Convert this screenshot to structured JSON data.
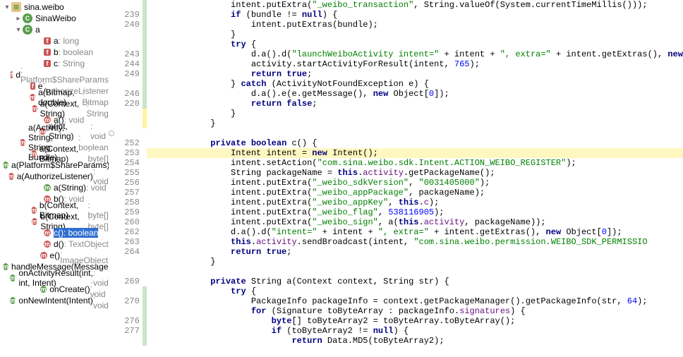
{
  "tree": {
    "root": {
      "label": "sina.weibo"
    },
    "classes": [
      {
        "label": "SinaWeibo"
      },
      {
        "label": "a",
        "members": [
          {
            "kind": "fld",
            "color": "red",
            "name": "a",
            "sig": " : long"
          },
          {
            "kind": "fld",
            "color": "red",
            "name": "b",
            "sig": " : boolean"
          },
          {
            "kind": "fld",
            "color": "red",
            "name": "c",
            "sig": " : String"
          },
          {
            "kind": "fld",
            "color": "red",
            "name": "d",
            "sig": " : Platform$ShareParams"
          },
          {
            "kind": "fld",
            "color": "red",
            "name": "e",
            "sig": " : AuthorizeListener"
          },
          {
            "kind": "mth",
            "color": "red",
            "name": "a(Bitmap, double)",
            "sig": " : Bitmap"
          },
          {
            "kind": "mth",
            "color": "red",
            "name": "a(Context, String)",
            "sig": " : String"
          },
          {
            "kind": "mth",
            "color": "red",
            "name": "a()",
            "sig": " : void"
          },
          {
            "kind": "mth",
            "color": "red",
            "name": "a(int, String)",
            "sig": " : void"
          },
          {
            "kind": "mth",
            "color": "red",
            "name": "a(Activity, String, String, Bundle)",
            "sig": " : boolean"
          },
          {
            "kind": "mth",
            "color": "red",
            "name": "a(Context, Bitmap)",
            "sig": " : byte[]"
          },
          {
            "kind": "mth",
            "color": "green",
            "name": "a(Platform$ShareParams)",
            "sig": " : void"
          },
          {
            "kind": "mth",
            "color": "red",
            "name": "a(AuthorizeListener)",
            "sig": " : void"
          },
          {
            "kind": "mth",
            "color": "green",
            "name": "a(String)",
            "sig": " : void"
          },
          {
            "kind": "mth",
            "color": "red",
            "name": "b()",
            "sig": " : void"
          },
          {
            "kind": "mth",
            "color": "red",
            "name": "b(Context, Bitmap)",
            "sig": " : byte[]"
          },
          {
            "kind": "mth",
            "color": "red",
            "name": "b(Context, String)",
            "sig": " : byte[]"
          },
          {
            "kind": "mth",
            "color": "red",
            "name": "c()",
            "sig": " : boolean",
            "selected": true
          },
          {
            "kind": "mth",
            "color": "red",
            "name": "d()",
            "sig": " : TextObject"
          },
          {
            "kind": "mth",
            "color": "red",
            "name": "e()",
            "sig": " : ImageObject"
          },
          {
            "kind": "mth",
            "color": "green",
            "name": "handleMessage(Message)",
            "sig": " : boolean"
          },
          {
            "kind": "mth",
            "color": "green",
            "name": "onActivityResult(int, int, Intent)",
            "sig": " : void"
          },
          {
            "kind": "mth",
            "color": "green",
            "name": "onCreate()",
            "sig": " : void"
          },
          {
            "kind": "mth",
            "color": "green",
            "name": "onNewIntent(Intent)",
            "sig": " : void"
          }
        ]
      }
    ]
  },
  "code": {
    "lines": [
      {
        "n": "",
        "bar": "green",
        "html": "                intent.putExtra(<span class='str'>\"_weibo_transaction\"</span>, String.valueOf(System.currentTimeMillis()));"
      },
      {
        "n": "239",
        "bar": "green",
        "html": "                <span class='kw'>if</span> (bundle != <span class='kw'>null</span>) {"
      },
      {
        "n": "240",
        "bar": "green",
        "html": "                    intent.putExtras(bundle);"
      },
      {
        "n": "",
        "bar": "green",
        "html": "                }"
      },
      {
        "n": "",
        "bar": "green",
        "html": "                <span class='kw'>try</span> {"
      },
      {
        "n": "243",
        "bar": "green",
        "html": "                    d.a().d(<span class='str'>\"launchWeiboActivity intent=\"</span> + intent + <span class='str'>\", extra=\"</span> + intent.getExtras(), <span class='kw'>new</span>"
      },
      {
        "n": "244",
        "bar": "green",
        "html": "                    activity.startActivityForResult(intent, <span class='num'>765</span>);"
      },
      {
        "n": "249",
        "bar": "green",
        "html": "                    <span class='kw'>return true</span>;"
      },
      {
        "n": "",
        "bar": "green",
        "html": "                } <span class='kw'>catch</span> (ActivityNotFoundException e) {"
      },
      {
        "n": "246",
        "bar": "green",
        "html": "                    d.a().e(e.getMessage(), <span class='kw'>new</span> Object[<span class='num'>0</span>]);"
      },
      {
        "n": "220",
        "bar": "green",
        "html": "                    <span class='kw'>return false</span>;"
      },
      {
        "n": "",
        "bar": "yellow",
        "html": "                }"
      },
      {
        "n": "",
        "bar": "yellow",
        "html": "            }"
      },
      {
        "n": "",
        "bar": "",
        "html": ""
      },
      {
        "n": "252",
        "bar": "",
        "html": "            <span class='kw'>private boolean</span> c() {"
      },
      {
        "n": "253",
        "bar": "",
        "hl": true,
        "html": "                Intent intent = <span class='kw'>new</span> Intent();"
      },
      {
        "n": "254",
        "bar": "",
        "html": "                intent.setAction(<span class='str'>\"com.sina.weibo.sdk.Intent.ACTION_WEIBO_REGISTER\"</span>);"
      },
      {
        "n": "255",
        "bar": "",
        "html": "                String packageName = <span class='kw'>this</span>.<span class='id'>activity</span>.getPackageName();"
      },
      {
        "n": "256",
        "bar": "",
        "html": "                intent.putExtra(<span class='str'>\"_weibo_sdkVersion\"</span>, <span class='str'>\"0031405000\"</span>);"
      },
      {
        "n": "257",
        "bar": "",
        "html": "                intent.putExtra(<span class='str'>\"_weibo_appPackage\"</span>, packageName);"
      },
      {
        "n": "258",
        "bar": "",
        "html": "                intent.putExtra(<span class='str'>\"_weibo_appKey\"</span>, <span class='kw'>this</span>.<span class='id'>c</span>);"
      },
      {
        "n": "259",
        "bar": "",
        "html": "                intent.putExtra(<span class='str'>\"_weibo_flag\"</span>, <span class='num'>538116905</span>);"
      },
      {
        "n": "260",
        "bar": "",
        "html": "                intent.putExtra(<span class='str'>\"_weibo_sign\"</span>, a(<span class='kw'>this</span>.<span class='id'>activity</span>, packageName));"
      },
      {
        "n": "262",
        "bar": "",
        "html": "                d.a().d(<span class='str'>\"intent=\"</span> + intent + <span class='str'>\", extra=\"</span> + intent.getExtras(), <span class='kw'>new</span> Object[<span class='num'>0</span>]);"
      },
      {
        "n": "263",
        "bar": "",
        "html": "                <span class='kw'>this</span>.<span class='id'>activity</span>.sendBroadcast(intent, <span class='str'>\"com.sina.weibo.permission.WEIBO_SDK_PERMISSIO</span>"
      },
      {
        "n": "264",
        "bar": "",
        "html": "                <span class='kw'>return true</span>;"
      },
      {
        "n": "",
        "bar": "",
        "html": "            }"
      },
      {
        "n": "",
        "bar": "",
        "html": ""
      },
      {
        "n": "269",
        "bar": "",
        "html": "            <span class='kw'>private</span> String a(Context context, String str) {"
      },
      {
        "n": "",
        "bar": "green",
        "html": "                <span class='kw'>try</span> {"
      },
      {
        "n": "270",
        "bar": "green",
        "html": "                    PackageInfo packageInfo = context.getPackageManager().getPackageInfo(str, <span class='num'>64</span>);"
      },
      {
        "n": "",
        "bar": "green",
        "html": "                    <span class='kw'>for</span> (Signature toByteArray : packageInfo.<span class='id'>signatures</span>) {"
      },
      {
        "n": "276",
        "bar": "green",
        "html": "                        <span class='kw'>byte</span>[] toByteArray2 = toByteArray.toByteArray();"
      },
      {
        "n": "277",
        "bar": "green",
        "html": "                        <span class='kw'>if</span> (toByteArray2 != <span class='kw'>null</span>) {"
      },
      {
        "n": "",
        "bar": "green",
        "html": "                            <span class='kw'>return</span> Data.MD5(toByteArray2);"
      }
    ]
  }
}
